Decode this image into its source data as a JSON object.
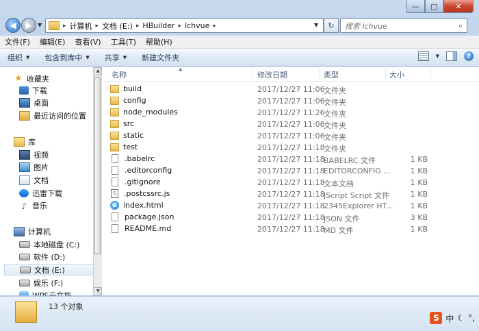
{
  "window": {
    "minimize": "—",
    "maximize": "□",
    "close": "✕"
  },
  "address": {
    "crumbs": [
      "计算机",
      "文档 (E:)",
      "HBuilder",
      "lchvue"
    ],
    "separator": "▸"
  },
  "search": {
    "placeholder": "搜索 lchvue"
  },
  "menu": [
    "文件(F)",
    "编辑(E)",
    "查看(V)",
    "工具(T)",
    "帮助(H)"
  ],
  "toolbar": {
    "organize": "组织",
    "include_library": "包含到库中",
    "share": "共享",
    "new_folder": "新建文件夹"
  },
  "nav": {
    "favorites": "收藏夹",
    "downloads": "下载",
    "desktop": "桌面",
    "recent": "最近访问的位置",
    "libraries": "库",
    "videos": "视频",
    "pictures": "图片",
    "documents": "文档",
    "thunder": "迅雷下载",
    "music": "音乐",
    "computer": "计算机",
    "drive_c": "本地磁盘 (C:)",
    "drive_d": "软件 (D:)",
    "drive_e": "文档 (E:)",
    "drive_f": "娱乐 (F:)",
    "wps": "WPS云文档"
  },
  "columns": {
    "name": "名称",
    "date": "修改日期",
    "type": "类型",
    "size": "大小"
  },
  "files": [
    {
      "name": "build",
      "date": "2017/12/27 11:06",
      "type": "文件夹",
      "size": "",
      "icon": "folder-icon"
    },
    {
      "name": "config",
      "date": "2017/12/27 11:06",
      "type": "文件夹",
      "size": "",
      "icon": "folder-icon"
    },
    {
      "name": "node_modules",
      "date": "2017/12/27 11:26",
      "type": "文件夹",
      "size": "",
      "icon": "folder-icon"
    },
    {
      "name": "src",
      "date": "2017/12/27 11:06",
      "type": "文件夹",
      "size": "",
      "icon": "folder-icon"
    },
    {
      "name": "static",
      "date": "2017/12/27 11:06",
      "type": "文件夹",
      "size": "",
      "icon": "folder-icon"
    },
    {
      "name": "test",
      "date": "2017/12/27 11:18",
      "type": "文件夹",
      "size": "",
      "icon": "folder-icon"
    },
    {
      "name": ".babelrc",
      "date": "2017/12/27 11:18",
      "type": "BABELRC 文件",
      "size": "1 KB",
      "icon": "file-icon"
    },
    {
      "name": ".editorconfig",
      "date": "2017/12/27 11:18",
      "type": "EDITORCONFIG ...",
      "size": "1 KB",
      "icon": "file-icon"
    },
    {
      "name": ".gitignore",
      "date": "2017/12/27 11:18",
      "type": "文本文档",
      "size": "1 KB",
      "icon": "file-icon"
    },
    {
      "name": ".postcssrc.js",
      "date": "2017/12/27 11:18",
      "type": "JScript Script 文件",
      "size": "1 KB",
      "icon": "js-file-icon"
    },
    {
      "name": "index.html",
      "date": "2017/12/27 11:18",
      "type": "2345Explorer HT...",
      "size": "1 KB",
      "icon": "browser-file-icon"
    },
    {
      "name": "package.json",
      "date": "2017/12/27 11:18",
      "type": "JSON 文件",
      "size": "3 KB",
      "icon": "file-icon"
    },
    {
      "name": "README.md",
      "date": "2017/12/27 11:18",
      "type": "MD 文件",
      "size": "1 KB",
      "icon": "file-icon"
    }
  ],
  "status": {
    "count": "13 个对象"
  },
  "tray": {
    "ime_logo": "S",
    "ime_lang": "中",
    "moon": "☾",
    "punct": "°,"
  }
}
